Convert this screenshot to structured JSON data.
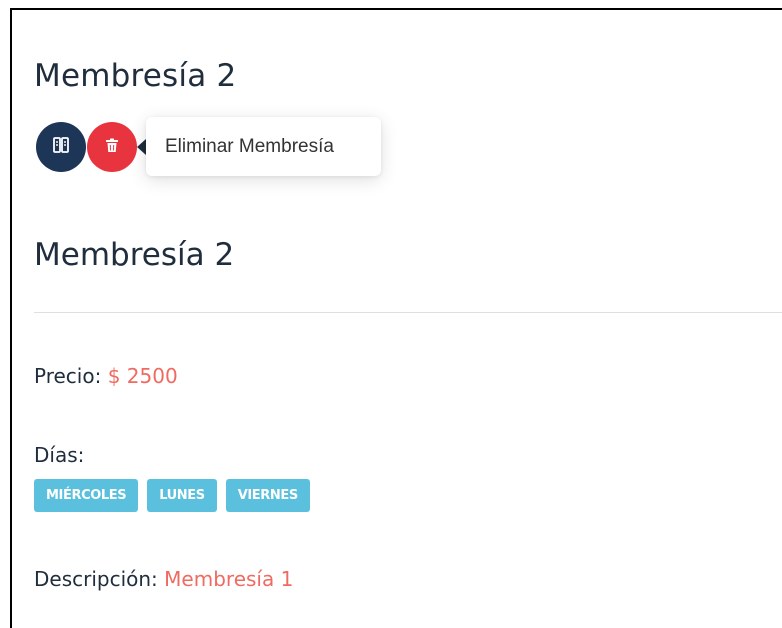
{
  "header": {
    "title": "Membresía 2"
  },
  "actions": {
    "edit_icon": "columns-icon",
    "delete_icon": "trash-icon",
    "edit_color": "#1d3557",
    "delete_color": "#e8343f"
  },
  "tooltip": {
    "text": "Eliminar Membresía"
  },
  "detail": {
    "title": "Membresía 2",
    "price_label": "Precio:",
    "price_value": "$ 2500",
    "days_label": "Días:",
    "days": [
      "MIÉRCOLES",
      "LUNES",
      "VIERNES"
    ],
    "description_label": "Descripción:",
    "description_value": "Membresía 1"
  },
  "colors": {
    "accent_value": "#ef6b61",
    "tag_bg": "#5bc0de",
    "heading": "#1f2d3d"
  }
}
